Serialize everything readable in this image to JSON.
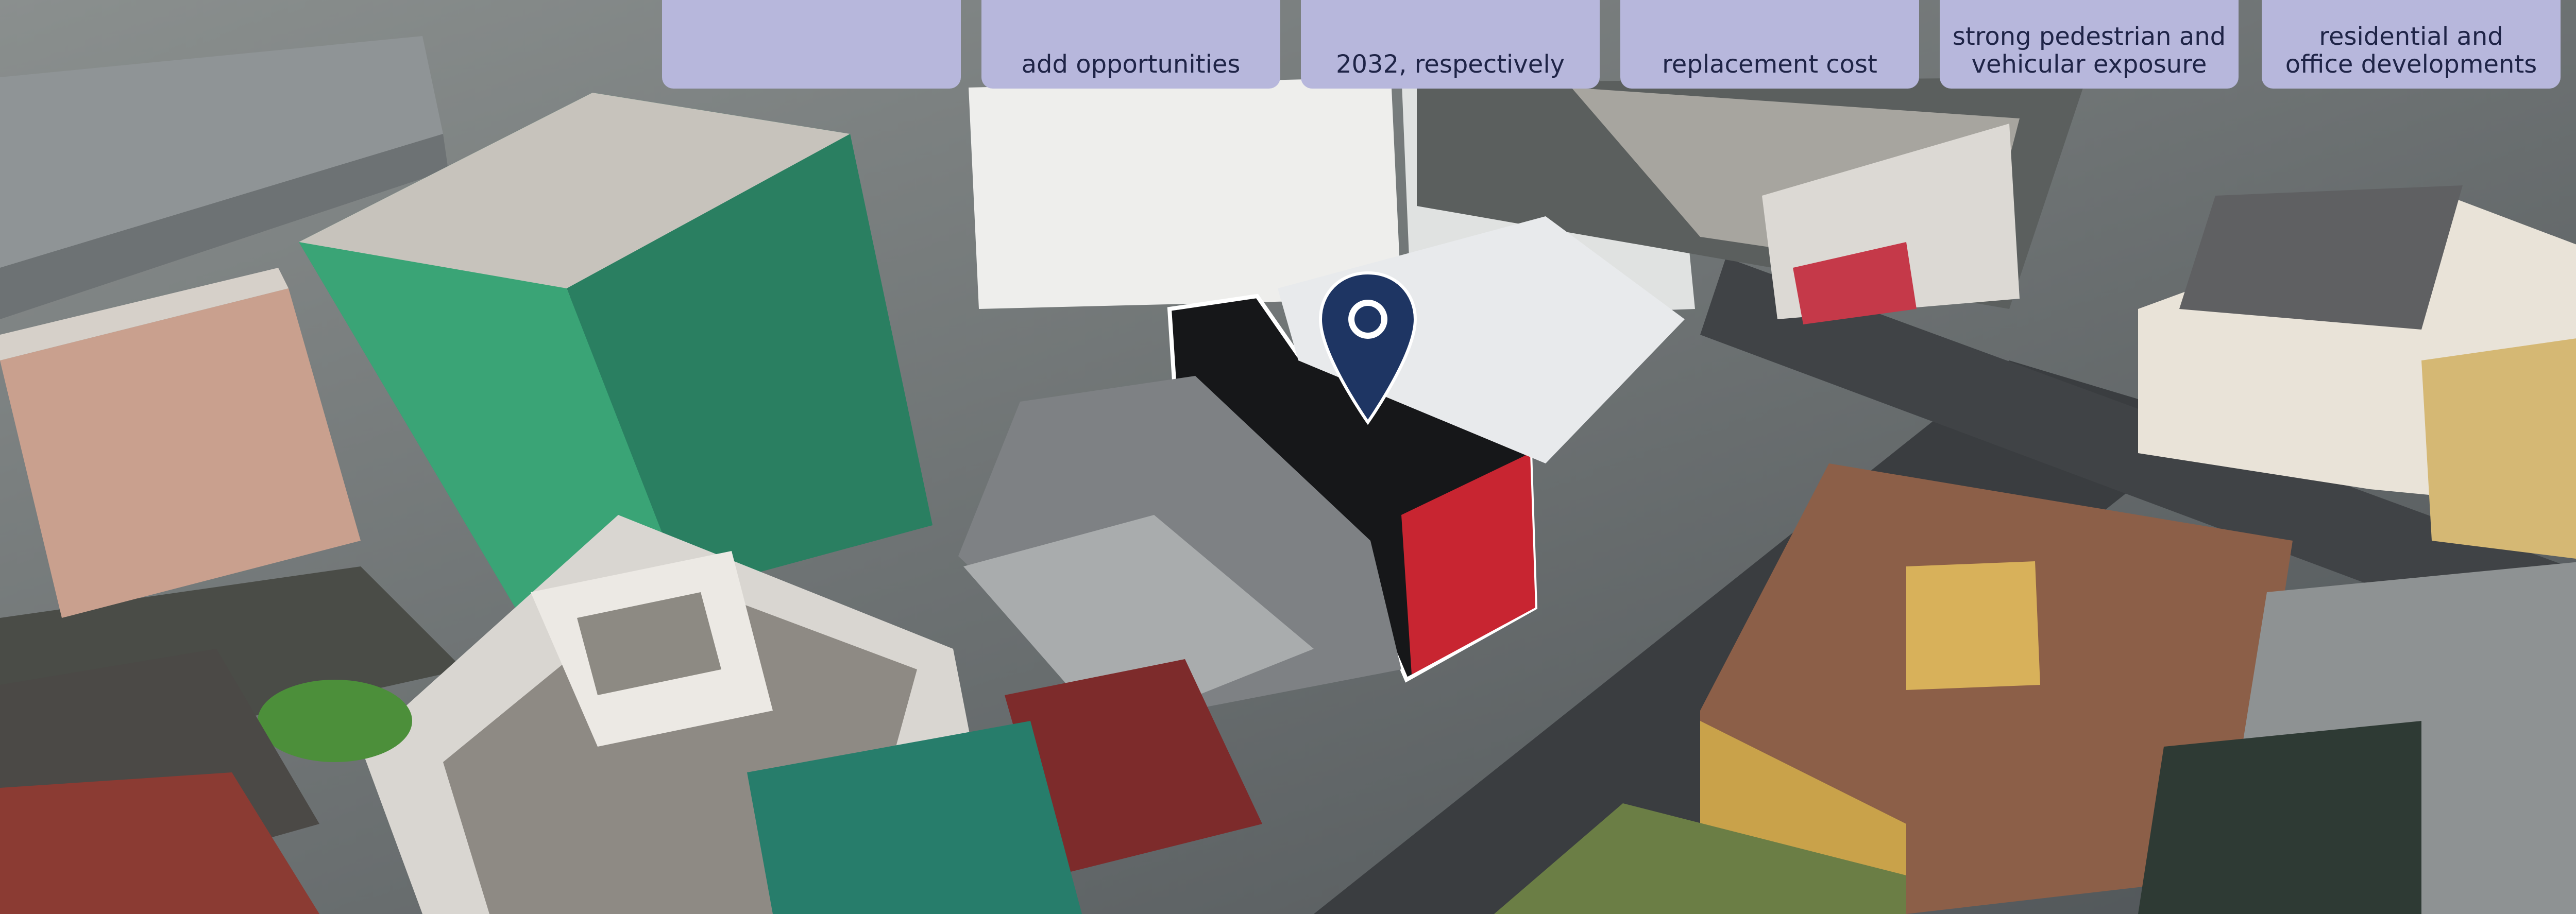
{
  "image": {
    "description": "Aerial photograph of a downtown block with a highlighted building and location pin",
    "colors": {
      "card": "#b7b7dc",
      "card_text": "#1f2447",
      "pin": "#1e3563",
      "highlight_outline": "#ffffff"
    }
  },
  "info_cards": [
    {
      "lines": [
        ""
      ]
    },
    {
      "lines": [
        "add opportunities"
      ]
    },
    {
      "lines": [
        "2032, respectively"
      ]
    },
    {
      "lines": [
        "replacement cost"
      ]
    },
    {
      "lines": [
        "strong pedestrian and",
        "vehicular exposure"
      ]
    },
    {
      "lines": [
        "residential and",
        "office developments"
      ]
    }
  ],
  "pin": {
    "icon": "location-pin-icon"
  }
}
